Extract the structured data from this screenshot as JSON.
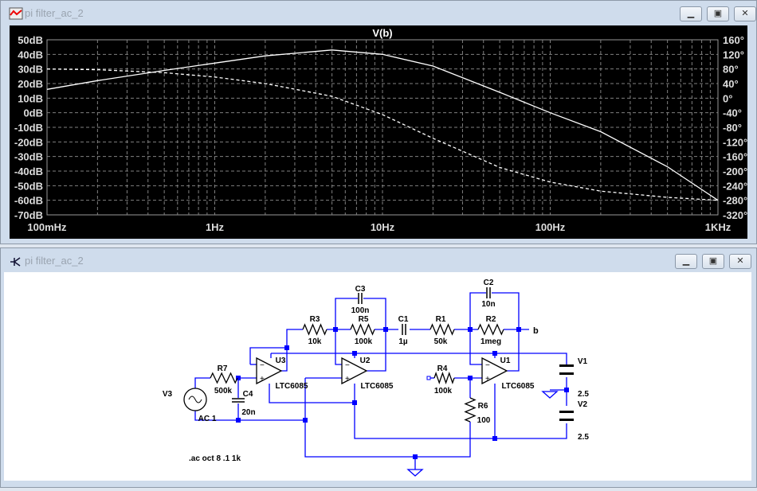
{
  "plot_window": {
    "title": "pi filter_ac_2",
    "icon": "waveform-icon",
    "buttons": [
      "minimize",
      "maximize",
      "close"
    ]
  },
  "schematic_window": {
    "title": "pi filter_ac_2",
    "icon": "schematic-icon",
    "buttons": [
      "minimize",
      "maximize",
      "close"
    ]
  },
  "chart_data": {
    "type": "line",
    "title": "V(b)",
    "xscale": "log",
    "x_ticks": [
      "100mHz",
      "1Hz",
      "10Hz",
      "100Hz",
      "1KHz"
    ],
    "xlim": [
      0.1,
      1000
    ],
    "ylim_left": [
      -70,
      50
    ],
    "ylim_right": [
      -320,
      160
    ],
    "y_ticks_left": [
      "50dB",
      "40dB",
      "30dB",
      "20dB",
      "10dB",
      "0dB",
      "-10dB",
      "-20dB",
      "-30dB",
      "-40dB",
      "-50dB",
      "-60dB",
      "-70dB"
    ],
    "y_ticks_right": [
      "160°",
      "120°",
      "80°",
      "40°",
      "0°",
      "-40°",
      "-80°",
      "-120°",
      "-160°",
      "-200°",
      "-240°",
      "-280°",
      "-320°"
    ],
    "grid": true,
    "x": [
      0.1,
      0.2,
      0.5,
      1,
      2,
      5,
      10,
      20,
      50,
      100,
      200,
      500,
      1000
    ],
    "series": [
      {
        "kind": "magnitude_dB",
        "style": "solid",
        "values": [
          16,
          22,
          29,
          34,
          39,
          43,
          40,
          32,
          14,
          0,
          -13,
          -37,
          -60
        ]
      },
      {
        "kind": "phase_deg",
        "style": "dashed",
        "values": [
          80,
          78,
          70,
          58,
          40,
          5,
          -45,
          -110,
          -190,
          -230,
          -255,
          -272,
          -280
        ]
      }
    ],
    "colors": {
      "background": "#000000",
      "trace": "#ffffff",
      "grid": "#808080"
    }
  },
  "schematic": {
    "components": [
      {
        "ref": "V3",
        "value": "AC 1"
      },
      {
        "ref": "R7",
        "value": "500k"
      },
      {
        "ref": "C4",
        "value": "20n"
      },
      {
        "ref": "U3",
        "value": "LTC6085"
      },
      {
        "ref": "R3",
        "value": "10k"
      },
      {
        "ref": "C3",
        "value": "100n"
      },
      {
        "ref": "R5",
        "value": "100k"
      },
      {
        "ref": "U2",
        "value": "LTC6085"
      },
      {
        "ref": "C1",
        "value": "1µ"
      },
      {
        "ref": "R1",
        "value": "50k"
      },
      {
        "ref": "C2",
        "value": "10n"
      },
      {
        "ref": "R2",
        "value": "1meg"
      },
      {
        "ref": "U1",
        "value": "LTC6085"
      },
      {
        "ref": "R4",
        "value": "100k"
      },
      {
        "ref": "R6",
        "value": "100"
      },
      {
        "ref": "V1",
        "value": "2.5"
      },
      {
        "ref": "V2",
        "value": "2.5"
      }
    ],
    "net_label": "b",
    "directive": ".ac oct 8 .1 1k",
    "wire_color": "#0000ff"
  }
}
